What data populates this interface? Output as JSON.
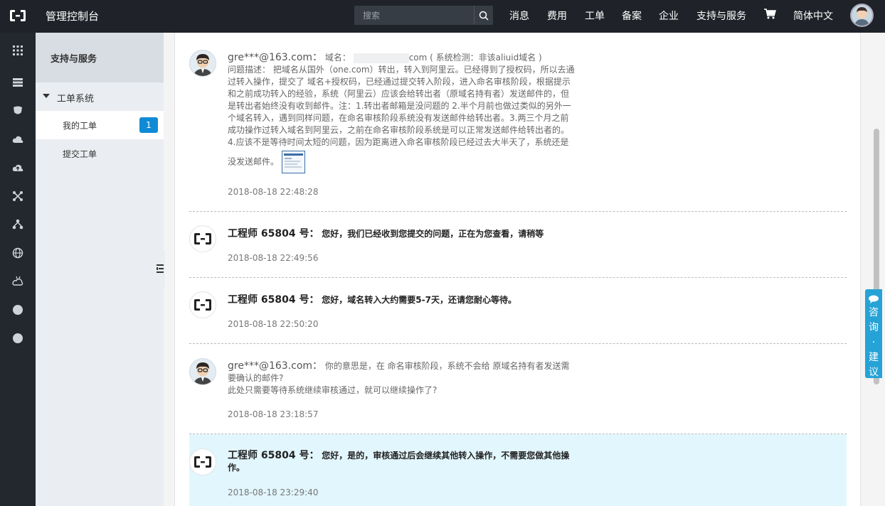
{
  "topbar": {
    "title": "管理控制台",
    "search_placeholder": "搜索",
    "nav": [
      "消息",
      "费用",
      "工单",
      "备案",
      "企业",
      "支持与服务",
      "简体中文"
    ]
  },
  "sidebar": {
    "header": "支持与服务",
    "group": "工单系统",
    "items": [
      {
        "label": "我的工单",
        "badge": "1"
      },
      {
        "label": "提交工单"
      }
    ]
  },
  "messages": [
    {
      "author": "gre***@163.com：",
      "domain_label": "域名：",
      "domain_suffix": "com ( 系统检测：非该aliuid域名 )",
      "text": "问题描述： 把域名从国外（one.com）转出，转入到阿里云。已经得到了授权码，所以去通过转入操作，提交了 域名+授权码，已经通过提交转入阶段，进入命名审核阶段，根据提示和之前成功转入的经验，系统（阿里云）应该会给转出者（原域名持有者）发送邮件的，但是转出者始终没有收到邮件。注：1.转出者邮箱是没问题的 2.半个月前也做过类似的另外一个域名转入，遇到同样问题，在命名审核阶段系统没有发送邮件给转出者。3.两三个月之前成功操作过转入域名到阿里云，之前在命名审核阶段系统是可以正常发送邮件给转出者的。4.应该不是等待时间太短的问题，因为距离进入命名审核阶段已经过去大半天了，系统还是",
      "text_end": "没发送邮件。",
      "time": "2018-08-18 22:48:28"
    },
    {
      "author": "工程师 65804 号：",
      "text": "您好，我们已经收到您提交的问题，正在为您查看，请稍等",
      "time": "2018-08-18 22:49:56"
    },
    {
      "author": "工程师 65804 号：",
      "text": "您好，域名转入大约需要5-7天，还请您耐心等待。",
      "time": "2018-08-18 22:50:20"
    },
    {
      "author": "gre***@163.com：",
      "text": "你的意思是，在 命名审核阶段，系统不会给 原域名持有者发送需要确认的邮件?",
      "text2": "此处只需要等待系统继续审核通过，就可以继续操作了?",
      "time": "2018-08-18 23:18:57"
    },
    {
      "author": "工程师 65804 号：",
      "text": "您好，是的，审核通过后会继续其他转入操作，不需要您做其他操作。",
      "time": "2018-08-18 23:29:40"
    }
  ],
  "consult": {
    "chars": [
      "咨",
      "询",
      "·",
      "建",
      "议"
    ]
  },
  "colors": {
    "topbar": "#1f2329",
    "badge": "#0f8bd6",
    "highlight": "#e2f6fd",
    "consult": "#26a3d6"
  }
}
